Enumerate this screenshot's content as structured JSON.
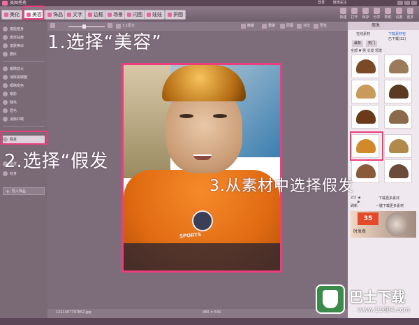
{
  "window": {
    "title": "美图秀秀",
    "links": [
      "登录",
      "微博关注"
    ]
  },
  "menu": {
    "tabs": [
      {
        "label": "美化",
        "icon": "beautify-icon"
      },
      {
        "label": "美容",
        "icon": "beauty-icon",
        "active": true
      },
      {
        "label": "饰品",
        "icon": "accessory-icon"
      },
      {
        "label": "文字",
        "icon": "text-icon"
      },
      {
        "label": "边框",
        "icon": "frame-icon"
      },
      {
        "label": "场景",
        "icon": "scene-icon"
      },
      {
        "label": "闪图",
        "icon": "flash-icon"
      },
      {
        "label": "娃娃",
        "icon": "doll-icon"
      },
      {
        "label": "拼图",
        "icon": "collage-icon"
      }
    ],
    "right_tools": [
      "新建",
      "打开",
      "保存",
      "分享",
      "帮助",
      "设置",
      "更多"
    ]
  },
  "sidebar": {
    "items": [
      {
        "label": "瘦脸瘦身",
        "active": false
      },
      {
        "label": "磨皮祛痘",
        "active": false
      },
      {
        "label": "皮肤美白",
        "active": false
      },
      {
        "label": "腮红",
        "active": false
      },
      {
        "label": "眼睛放大",
        "active": false
      },
      {
        "label": "消除黑眼圈",
        "active": false
      },
      {
        "label": "眼睛变色",
        "active": false
      },
      {
        "label": "眼影",
        "active": false
      },
      {
        "label": "睫毛",
        "active": false
      },
      {
        "label": "眉毛",
        "active": false
      },
      {
        "label": "消除红眼",
        "active": false
      },
      {
        "label": "假发",
        "active": true
      },
      {
        "label": "染发",
        "active": false
      },
      {
        "label": "纹身",
        "active": false
      }
    ],
    "import_button": "导入饰品"
  },
  "toolbar": {
    "zoom_label": "1:1原大",
    "undo": "撤销",
    "redo": "重做",
    "reset": "原图",
    "compare": "对比",
    "preview": "预览"
  },
  "status": {
    "filename": "1221307797852.jpg",
    "dimensions": "480 × 640"
  },
  "right_panel": {
    "title": "假发",
    "online_label": "在线素材",
    "download_link": "下载素材包",
    "downloaded": "已下载(32)",
    "categories": [
      "最新",
      "热门"
    ],
    "filter": "全部 ▼ 男 长发 短发",
    "page": "2/2",
    "more_link": "下载更多素材",
    "refresh": "刷新",
    "download_more": "一键下载更多素材",
    "promo_badge": "35",
    "promo_tag": "时发表",
    "thumbs": [
      {
        "color": "#7a4a28"
      },
      {
        "color": "#9a7a5a"
      },
      {
        "color": "#c99a5a"
      },
      {
        "color": "#5a3a22"
      },
      {
        "color": "#6a3a1a"
      },
      {
        "color": "#8a6a4a"
      },
      {
        "color": "#d08a2a",
        "selected": true
      },
      {
        "color": "#b08a4a"
      }
    ]
  },
  "annotations": {
    "step1": "1.选择“美容”",
    "step2": "2.选择“假发",
    "step3": "3.从素材中选择假发"
  },
  "watermark": {
    "text": "巴士下载",
    "url": "www.11684.com"
  },
  "photo": {
    "shirt_text": "SPORTS"
  }
}
